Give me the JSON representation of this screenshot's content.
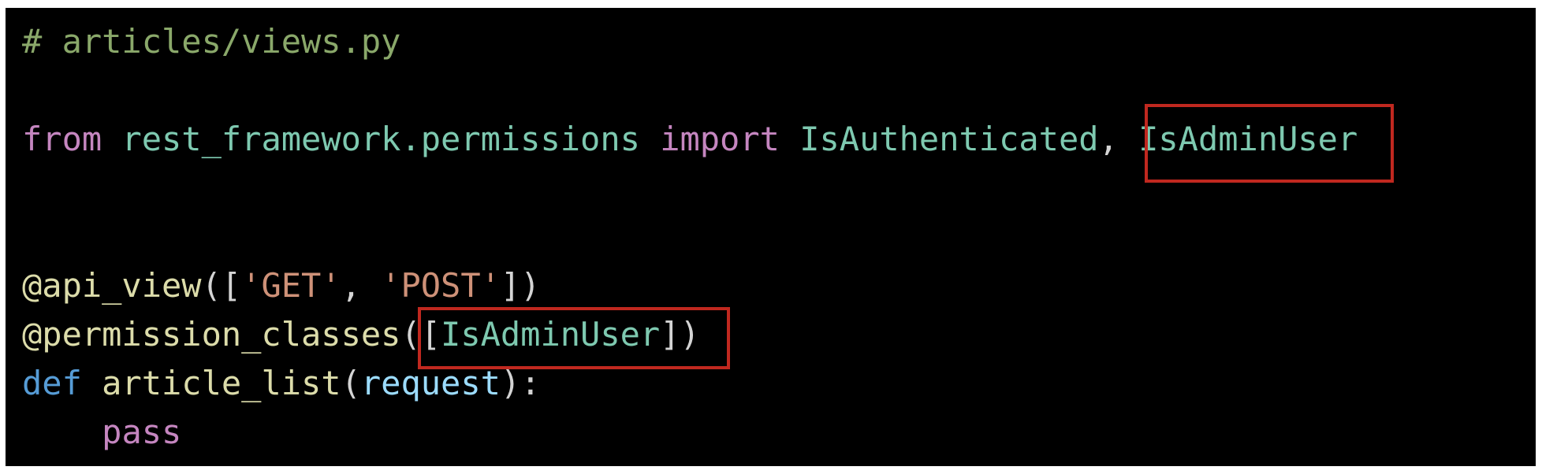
{
  "colors": {
    "background": "#000000",
    "comment": "#8aa86a",
    "keyword": "#c586c0",
    "module": "#7ec9b0",
    "plain": "#d4d4d4",
    "decorator": "#dcdcaa",
    "string": "#ce9178",
    "def_keyword": "#569cd6",
    "param": "#9cdcfe",
    "highlight": "#c0281f"
  },
  "code": {
    "comment": "# articles/views.py",
    "line_import": {
      "from": "from",
      "module": "rest_framework.permissions",
      "import": "import",
      "name1": "IsAuthenticated",
      "comma": ",",
      "name2": "IsAdminUser"
    },
    "line_api_view": {
      "decorator": "@api_view",
      "open": "([",
      "str1": "'GET'",
      "sep": ", ",
      "str2": "'POST'",
      "close": "])"
    },
    "line_perm": {
      "decorator": "@permission_classes",
      "open": "(",
      "bracket_open": "[",
      "name": "IsAdminUser",
      "bracket_close": "]",
      "close": ")"
    },
    "line_def": {
      "def": "def",
      "func": "article_list",
      "open": "(",
      "param": "request",
      "close": "):"
    },
    "line_pass": {
      "indent": "    ",
      "pass": "pass"
    }
  }
}
